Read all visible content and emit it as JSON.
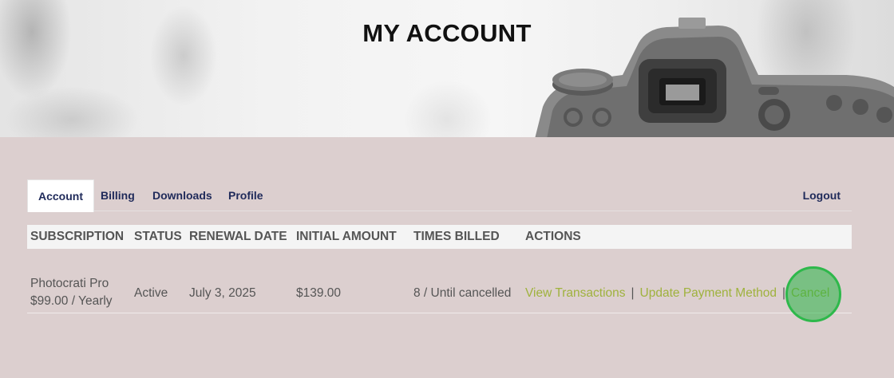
{
  "page": {
    "title": "MY ACCOUNT"
  },
  "tabs": {
    "account": "Account",
    "billing": "Billing",
    "downloads": "Downloads",
    "profile": "Profile",
    "logout": "Logout"
  },
  "table": {
    "headers": {
      "subscription": "SUBSCRIPTION",
      "status": "STATUS",
      "renewal_date": "RENEWAL DATE",
      "initial_amount": "INITIAL AMOUNT",
      "times_billed": "TIMES BILLED",
      "actions": "ACTIONS"
    },
    "rows": [
      {
        "subscription_name": "Photocrati Pro",
        "subscription_price": "$99.00 / Yearly",
        "status": "Active",
        "renewal_date": "July 3, 2025",
        "initial_amount": "$139.00",
        "times_billed": "8 / Until cancelled",
        "actions": {
          "view_transactions": "View Transactions",
          "update_payment": "Update Payment Method",
          "cancel": "Cancel",
          "separator": "|"
        }
      }
    ]
  },
  "colors": {
    "background": "#dccfcf",
    "tab_text": "#1f2a5a",
    "action_link": "#9fb23d",
    "click_indicator": "#2eb84b"
  },
  "icons": {
    "hero_image": "camera-icon"
  }
}
